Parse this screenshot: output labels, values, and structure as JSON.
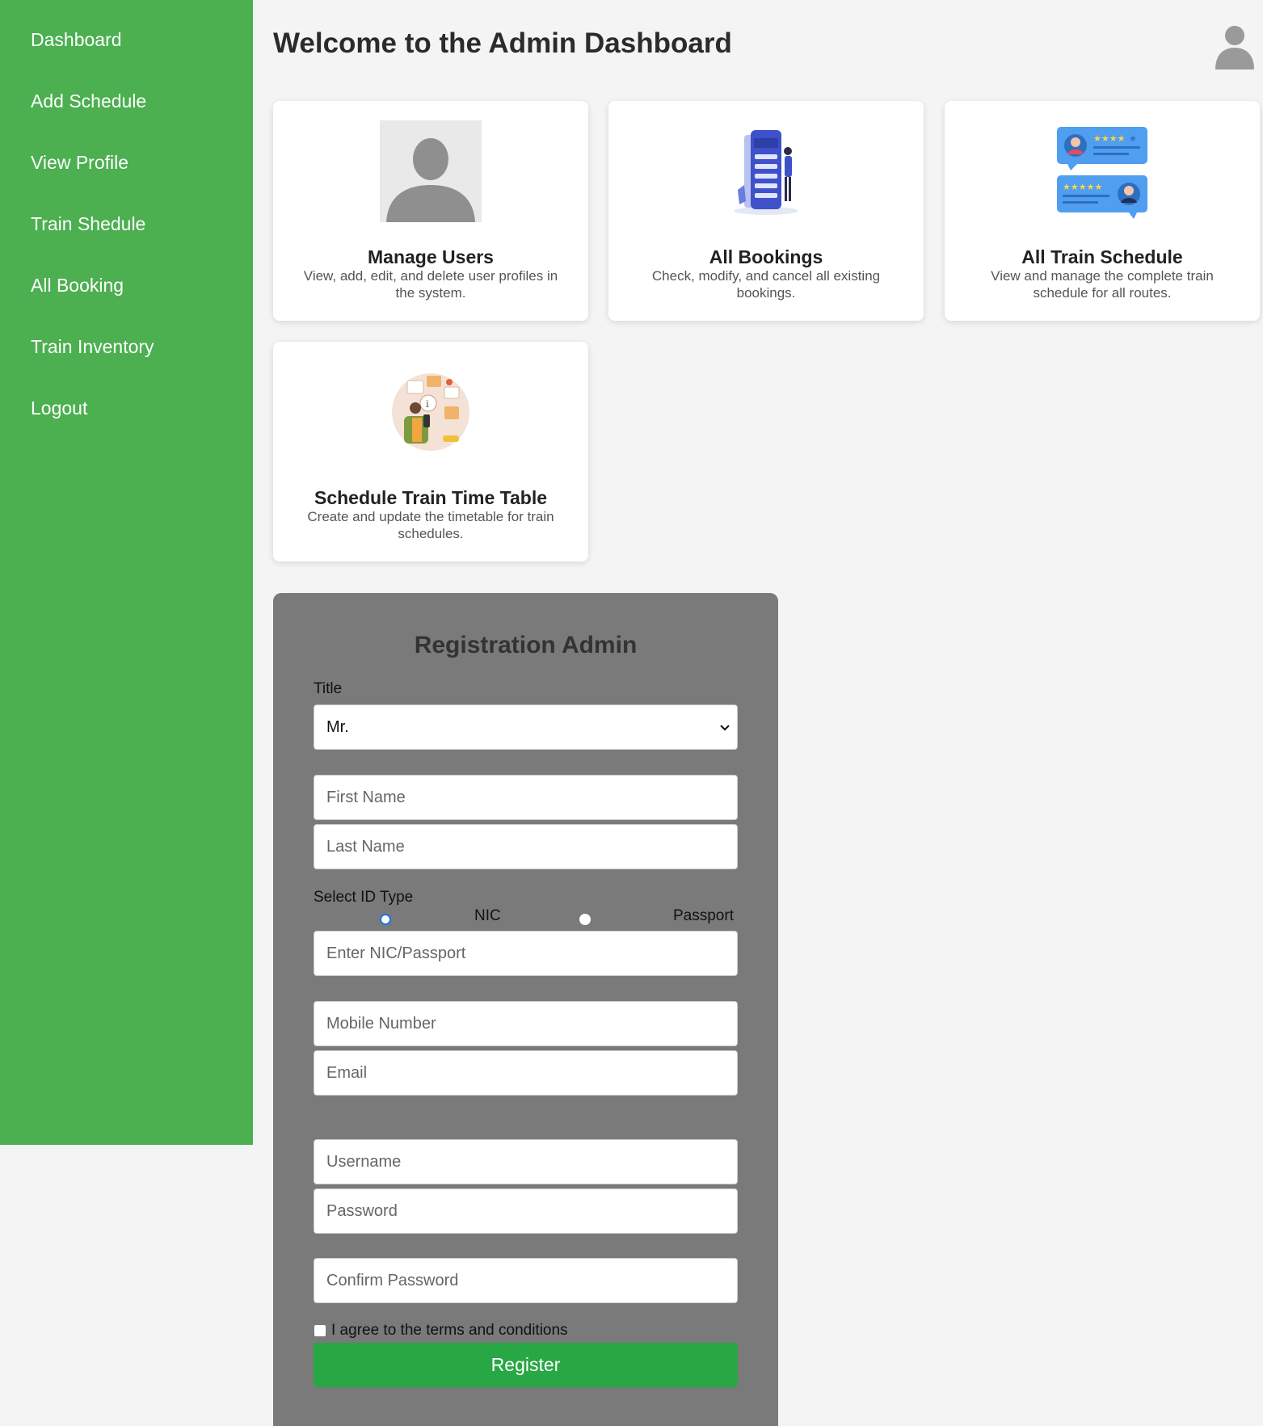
{
  "sidebar": {
    "items": [
      {
        "label": "Dashboard"
      },
      {
        "label": "Add Schedule"
      },
      {
        "label": "View Profile"
      },
      {
        "label": "Train Shedule"
      },
      {
        "label": "All Booking"
      },
      {
        "label": "Train Inventory"
      },
      {
        "label": "Logout"
      }
    ]
  },
  "header": {
    "title": "Welcome to the Admin Dashboard",
    "avatar_icon": "user-avatar-icon"
  },
  "cards": [
    {
      "title": "Manage Users",
      "desc": "View, add, edit, and delete user profiles in the system.",
      "icon": "user-silhouette-icon"
    },
    {
      "title": "All Bookings",
      "desc": "Check, modify, and cancel all existing bookings.",
      "icon": "mobile-booking-icon"
    },
    {
      "title": "All Train Schedule",
      "desc": "View and manage the complete train schedule for all routes.",
      "icon": "reviews-chat-icon"
    },
    {
      "title": "Schedule Train Time Table",
      "desc": "Create and update the timetable for train schedules.",
      "icon": "travel-planner-icon"
    }
  ],
  "registration": {
    "heading": "Registration Admin",
    "title_label": "Title",
    "title_value": "Mr.",
    "first_name_placeholder": "First Name",
    "last_name_placeholder": "Last Name",
    "id_type_label": "Select ID Type",
    "id_options": [
      "NIC",
      "Passport"
    ],
    "id_selected": "NIC",
    "id_placeholder": "Enter NIC/Passport",
    "mobile_placeholder": "Mobile Number",
    "email_placeholder": "Email",
    "username_placeholder": "Username",
    "password_placeholder": "Password",
    "confirm_password_placeholder": "Confirm Password",
    "terms_label": "I agree to the terms and conditions",
    "register_label": "Register"
  },
  "colors": {
    "sidebar": "#4caf50",
    "register_button": "#28a745",
    "form_panel": "#7a7a7a"
  }
}
